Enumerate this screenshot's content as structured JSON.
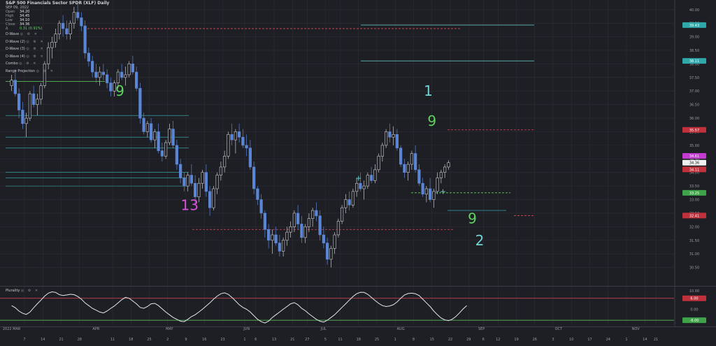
{
  "header": {
    "title": "S&P 500 Financials Sector SPDR (XLF) Daily",
    "date": "SEP 09, 2022",
    "ohlc": [
      {
        "k": "Open",
        "v": "34.20"
      },
      {
        "k": "High",
        "v": "34.45"
      },
      {
        "k": "Low",
        "v": "34.10"
      },
      {
        "k": "Close",
        "v": "34.36"
      }
    ],
    "change": "0.31 (0.91%)"
  },
  "indicators": [
    {
      "label": "D-Wave"
    },
    {
      "label": "D-Wave (2)"
    },
    {
      "label": "D-Wave (3)"
    },
    {
      "label": "D-Wave (4)"
    },
    {
      "label": "Combo"
    },
    {
      "label": "Range Projection"
    }
  ],
  "controls_glyphs": "◎ ⚙ ✕",
  "lower_panel": {
    "label": "Plurality"
  },
  "colors": {
    "background": "#1e1f24",
    "grid": "#2d2f36",
    "up_candle": "#1e1f24",
    "up_border": "#c8cacf",
    "down_candle": "#5b86d6",
    "green_seq": "#5fd35f",
    "red_seq": "#e04858",
    "cyan": "#6fd3d3",
    "magenta": "#d94fd9",
    "price_box_cyan": "#2ea8a8",
    "price_box_red": "#c0313c",
    "price_box_magenta": "#c23ad0",
    "price_box_green": "#3fa34a"
  },
  "chart_data": [
    {
      "type": "candlestick",
      "x_axis_labels": [
        {
          "t": 0.5,
          "label": "2022 MAR"
        },
        {
          "t": 4,
          "label": "7"
        },
        {
          "t": 9,
          "label": "14"
        },
        {
          "t": 14,
          "label": "21"
        },
        {
          "t": 19,
          "label": "28"
        },
        {
          "t": 23.5,
          "label": "APR"
        },
        {
          "t": 28,
          "label": "11"
        },
        {
          "t": 33,
          "label": "18"
        },
        {
          "t": 38,
          "label": "25"
        },
        {
          "t": 43,
          "label": "2"
        },
        {
          "t": 43.5,
          "label": "MAY"
        },
        {
          "t": 48,
          "label": "9"
        },
        {
          "t": 53,
          "label": "16"
        },
        {
          "t": 58,
          "label": "23"
        },
        {
          "t": 64.5,
          "label": "JUN"
        },
        {
          "t": 64,
          "label": "1"
        },
        {
          "t": 67,
          "label": "6"
        },
        {
          "t": 72,
          "label": "13"
        },
        {
          "t": 77,
          "label": "21"
        },
        {
          "t": 81,
          "label": "27"
        },
        {
          "t": 85.5,
          "label": "JUL"
        },
        {
          "t": 86,
          "label": "5"
        },
        {
          "t": 90,
          "label": "11"
        },
        {
          "t": 95,
          "label": "18"
        },
        {
          "t": 100,
          "label": "25"
        },
        {
          "t": 106.5,
          "label": "AUG"
        },
        {
          "t": 105,
          "label": "1"
        },
        {
          "t": 110,
          "label": "8"
        },
        {
          "t": 115,
          "label": "15"
        },
        {
          "t": 120,
          "label": "22"
        },
        {
          "t": 125,
          "label": "29"
        },
        {
          "t": 128.5,
          "label": "SEP"
        },
        {
          "t": 129,
          "label": "6"
        },
        {
          "t": 133,
          "label": "12"
        },
        {
          "t": 138,
          "label": "19"
        },
        {
          "t": 143,
          "label": "26"
        },
        {
          "t": 148,
          "label": "3"
        },
        {
          "t": 149.5,
          "label": "OCT"
        },
        {
          "t": 153,
          "label": "10"
        },
        {
          "t": 158,
          "label": "17"
        },
        {
          "t": 163,
          "label": "24"
        },
        {
          "t": 168,
          "label": "1"
        },
        {
          "t": 170.5,
          "label": "NOV"
        },
        {
          "t": 173,
          "label": "14"
        },
        {
          "t": 176,
          "label": "21"
        }
      ],
      "y_axis": {
        "min": 30.0,
        "max": 40.2,
        "ticks": [
          "40.00",
          "39.50",
          "39.00",
          "38.50",
          "38.00",
          "37.50",
          "37.00",
          "36.50",
          "36.00",
          "35.50",
          "35.00",
          "34.50",
          "34.00",
          "33.50",
          "33.00",
          "32.50",
          "32.00",
          "31.50",
          "31.00",
          "30.50"
        ]
      },
      "candles": [
        [
          37.2,
          37.6,
          37.0,
          37.4
        ],
        [
          37.4,
          37.8,
          36.8,
          36.9
        ],
        [
          36.9,
          37.1,
          36.0,
          36.3
        ],
        [
          36.3,
          36.6,
          35.6,
          35.8
        ],
        [
          35.8,
          36.2,
          35.3,
          36.0
        ],
        [
          36.0,
          37.0,
          35.9,
          36.9
        ],
        [
          36.9,
          37.2,
          36.4,
          36.5
        ],
        [
          36.5,
          36.9,
          36.1,
          36.7
        ],
        [
          36.7,
          37.3,
          36.5,
          37.2
        ],
        [
          37.2,
          38.1,
          37.1,
          38.0
        ],
        [
          38.0,
          38.8,
          37.8,
          38.6
        ],
        [
          38.6,
          39.0,
          38.2,
          38.8
        ],
        [
          38.8,
          39.3,
          38.6,
          39.1
        ],
        [
          39.1,
          39.6,
          38.9,
          39.5
        ],
        [
          39.5,
          39.8,
          39.0,
          39.3
        ],
        [
          39.3,
          39.6,
          38.9,
          39.1
        ],
        [
          39.1,
          39.6,
          38.9,
          39.5
        ],
        [
          39.5,
          40.1,
          39.3,
          39.9
        ],
        [
          39.9,
          40.2,
          39.6,
          39.7
        ],
        [
          39.7,
          39.9,
          39.2,
          39.4
        ],
        [
          39.4,
          39.6,
          38.2,
          38.4
        ],
        [
          38.4,
          38.6,
          37.9,
          38.1
        ],
        [
          38.1,
          38.3,
          37.5,
          37.7
        ],
        [
          37.7,
          38.0,
          37.3,
          37.5
        ],
        [
          37.5,
          37.9,
          37.2,
          37.7
        ],
        [
          37.7,
          38.0,
          37.4,
          37.6
        ],
        [
          37.6,
          37.8,
          37.1,
          37.3
        ],
        [
          37.3,
          37.5,
          36.8,
          37.0
        ],
        [
          37.0,
          37.4,
          36.8,
          37.3
        ],
        [
          37.3,
          37.8,
          37.1,
          37.7
        ],
        [
          37.7,
          38.0,
          37.4,
          37.5
        ],
        [
          37.5,
          37.9,
          37.2,
          37.6
        ],
        [
          37.6,
          38.1,
          37.5,
          38.0
        ],
        [
          38.0,
          38.3,
          37.6,
          37.7
        ],
        [
          37.7,
          37.9,
          37.0,
          37.1
        ],
        [
          37.1,
          37.3,
          35.8,
          36.0
        ],
        [
          36.0,
          36.2,
          35.4,
          35.5
        ],
        [
          35.5,
          35.9,
          35.3,
          35.8
        ],
        [
          35.8,
          36.0,
          35.1,
          35.2
        ],
        [
          35.2,
          35.6,
          34.9,
          35.5
        ],
        [
          35.5,
          35.8,
          34.7,
          34.8
        ],
        [
          34.8,
          35.1,
          34.4,
          34.6
        ],
        [
          34.6,
          35.2,
          34.5,
          35.1
        ],
        [
          35.1,
          35.8,
          35.0,
          35.6
        ],
        [
          35.6,
          35.9,
          34.9,
          35.0
        ],
        [
          35.0,
          35.2,
          34.1,
          34.3
        ],
        [
          34.3,
          34.5,
          33.6,
          33.8
        ],
        [
          33.8,
          34.0,
          33.3,
          33.5
        ],
        [
          33.5,
          34.0,
          33.3,
          33.9
        ],
        [
          33.9,
          34.3,
          33.5,
          33.6
        ],
        [
          33.6,
          33.9,
          32.8,
          33.1
        ],
        [
          33.1,
          33.8,
          32.9,
          33.6
        ],
        [
          33.6,
          34.1,
          33.4,
          34.0
        ],
        [
          34.0,
          34.3,
          33.1,
          33.3
        ],
        [
          33.3,
          33.5,
          32.4,
          32.7
        ],
        [
          32.7,
          33.5,
          32.6,
          33.4
        ],
        [
          33.4,
          34.0,
          33.2,
          33.9
        ],
        [
          33.9,
          34.4,
          33.7,
          34.2
        ],
        [
          34.2,
          34.8,
          34.0,
          34.6
        ],
        [
          34.6,
          35.5,
          34.5,
          35.4
        ],
        [
          35.4,
          35.8,
          35.0,
          35.2
        ],
        [
          35.2,
          35.6,
          34.7,
          35.5
        ],
        [
          35.5,
          35.8,
          35.1,
          35.3
        ],
        [
          35.3,
          35.6,
          34.9,
          35.0
        ],
        [
          35.0,
          35.4,
          34.6,
          34.9
        ],
        [
          34.9,
          35.2,
          34.1,
          34.2
        ],
        [
          34.2,
          34.4,
          33.2,
          33.4
        ],
        [
          33.4,
          33.5,
          32.8,
          33.0
        ],
        [
          33.0,
          33.2,
          32.3,
          32.5
        ],
        [
          32.5,
          32.6,
          31.6,
          31.9
        ],
        [
          31.9,
          32.1,
          31.2,
          31.5
        ],
        [
          31.5,
          31.9,
          31.0,
          31.7
        ],
        [
          31.7,
          32.0,
          31.3,
          31.4
        ],
        [
          31.4,
          31.7,
          30.9,
          31.1
        ],
        [
          31.1,
          31.6,
          30.9,
          31.5
        ],
        [
          31.5,
          32.0,
          31.3,
          31.8
        ],
        [
          31.8,
          32.2,
          31.6,
          32.0
        ],
        [
          32.0,
          32.6,
          31.8,
          32.5
        ],
        [
          32.5,
          32.8,
          31.9,
          32.1
        ],
        [
          32.1,
          32.4,
          31.4,
          31.6
        ],
        [
          31.6,
          32.1,
          31.4,
          32.0
        ],
        [
          32.0,
          32.5,
          31.8,
          32.3
        ],
        [
          32.3,
          32.7,
          32.0,
          32.6
        ],
        [
          32.6,
          32.9,
          32.2,
          32.4
        ],
        [
          32.4,
          32.6,
          31.5,
          31.7
        ],
        [
          31.7,
          32.0,
          31.2,
          31.4
        ],
        [
          31.4,
          31.6,
          30.6,
          30.8
        ],
        [
          30.8,
          31.3,
          30.5,
          31.2
        ],
        [
          31.2,
          31.8,
          31.0,
          31.7
        ],
        [
          31.7,
          32.3,
          31.6,
          32.2
        ],
        [
          32.2,
          32.8,
          32.1,
          32.7
        ],
        [
          32.7,
          33.2,
          32.5,
          33.0
        ],
        [
          33.0,
          33.3,
          32.6,
          32.8
        ],
        [
          32.8,
          33.4,
          32.7,
          33.3
        ],
        [
          33.3,
          33.8,
          33.1,
          33.6
        ],
        [
          33.6,
          34.0,
          33.3,
          33.4
        ],
        [
          33.4,
          33.7,
          33.0,
          33.5
        ],
        [
          33.5,
          34.0,
          33.4,
          33.9
        ],
        [
          33.9,
          34.2,
          33.6,
          33.7
        ],
        [
          33.7,
          34.3,
          33.6,
          34.1
        ],
        [
          34.1,
          34.7,
          34.0,
          34.6
        ],
        [
          34.6,
          35.1,
          34.4,
          35.0
        ],
        [
          35.0,
          35.6,
          34.9,
          35.5
        ],
        [
          35.5,
          35.8,
          35.1,
          35.3
        ],
        [
          35.3,
          35.7,
          35.0,
          35.4
        ],
        [
          35.4,
          35.6,
          34.8,
          34.9
        ],
        [
          34.9,
          35.0,
          34.2,
          34.3
        ],
        [
          34.3,
          34.5,
          33.8,
          34.0
        ],
        [
          34.0,
          34.4,
          33.7,
          34.3
        ],
        [
          34.3,
          34.8,
          34.1,
          34.7
        ],
        [
          34.7,
          35.0,
          34.0,
          34.1
        ],
        [
          34.1,
          34.3,
          33.5,
          33.6
        ],
        [
          33.6,
          33.8,
          33.1,
          33.2
        ],
        [
          33.2,
          33.5,
          32.9,
          33.4
        ],
        [
          33.4,
          33.8,
          32.9,
          33.0
        ],
        [
          33.0,
          33.4,
          32.7,
          33.3
        ],
        [
          33.3,
          34.0,
          33.2,
          33.8
        ],
        [
          33.8,
          34.1,
          33.6,
          34.0
        ],
        [
          34.0,
          34.3,
          33.8,
          34.2
        ],
        [
          34.2,
          34.45,
          34.1,
          34.36
        ]
      ],
      "reference_lines": [
        {
          "price": 39.43,
          "label": "39.43",
          "style": "solid",
          "color": "cyan"
        },
        {
          "price": 38.11,
          "label": "38.11",
          "style": "solid",
          "color": "cyan"
        },
        {
          "price": 39.3,
          "style": "dashed",
          "color": "red"
        },
        {
          "price": 35.57,
          "label": "35.57",
          "style": "dashed",
          "color": "red"
        },
        {
          "price": 33.25,
          "label": "33.25",
          "style": "dashed",
          "color": "green"
        },
        {
          "price": 32.41,
          "label": "32.41",
          "style": "dashed",
          "color": "red"
        },
        {
          "price": 31.9,
          "style": "dashed",
          "color": "red"
        },
        {
          "price": 37.35,
          "style": "solid",
          "color": "green"
        }
      ],
      "price_boxes": [
        {
          "price": 34.61,
          "label": "34.61",
          "color": "magenta"
        },
        {
          "price": 34.36,
          "label": "34.36",
          "color": "white"
        },
        {
          "price": 34.11,
          "label": "34.11",
          "color": "red"
        }
      ],
      "annotations": [
        {
          "text": "9",
          "t": 30,
          "price": 37.0,
          "color": "green",
          "size": "large"
        },
        {
          "text": "13",
          "t": 49,
          "price": 32.8,
          "color": "magenta",
          "size": "large"
        },
        {
          "text": "1",
          "t": 114,
          "price": 37.0,
          "color": "cyan",
          "size": "large"
        },
        {
          "text": "9",
          "t": 115,
          "price": 35.9,
          "color": "green",
          "size": "large"
        },
        {
          "text": "9",
          "t": 126,
          "price": 32.3,
          "color": "green",
          "size": "large"
        },
        {
          "text": "2",
          "t": 128,
          "price": 31.5,
          "color": "cyan",
          "size": "large"
        },
        {
          "text": "+",
          "t": 95,
          "price": 33.8,
          "color": "cyan",
          "size": "medium"
        },
        {
          "text": "+",
          "t": 118,
          "price": 33.3,
          "color": "cyan",
          "size": "medium"
        }
      ]
    },
    {
      "type": "line",
      "name": "Plurality",
      "y_ticks": [
        "10.00",
        "6.00",
        "0.00",
        "-6.00"
      ],
      "reference_levels": [
        {
          "value": 6.0,
          "label": "6.00",
          "color": "red"
        },
        {
          "value": -6.0,
          "label": "-6.00",
          "color": "green"
        }
      ],
      "ylim": [
        -9,
        12
      ],
      "values": [
        2.0,
        0.8,
        -1.0,
        -2.2,
        -2.8,
        -1.5,
        0.8,
        3.0,
        5.0,
        7.2,
        8.8,
        9.5,
        9.2,
        8.0,
        7.5,
        7.8,
        8.2,
        8.0,
        7.0,
        5.5,
        3.5,
        2.0,
        0.5,
        -0.5,
        -1.5,
        -2.0,
        -1.0,
        0.5,
        1.8,
        3.5,
        5.2,
        6.5,
        6.0,
        4.5,
        3.0,
        1.0,
        0.5,
        1.5,
        3.0,
        3.2,
        2.0,
        0.2,
        -1.5,
        -3.0,
        -4.5,
        -5.5,
        -6.5,
        -6.8,
        -5.5,
        -4.0,
        -3.0,
        -1.5,
        0.0,
        1.8,
        3.5,
        5.5,
        7.2,
        8.5,
        9.0,
        8.2,
        6.5,
        4.5,
        2.5,
        1.0,
        0.0,
        -1.5,
        -3.5,
        -5.5,
        -6.8,
        -7.5,
        -6.5,
        -4.5,
        -3.0,
        -1.5,
        0.0,
        1.5,
        3.0,
        3.6,
        2.5,
        0.5,
        -0.8,
        -2.5,
        -4.0,
        -5.5,
        -6.5,
        -7.0,
        -6.0,
        -4.5,
        -3.0,
        -1.0,
        1.0,
        3.0,
        5.0,
        7.0,
        8.5,
        9.3,
        9.2,
        8.2,
        6.5,
        4.8,
        3.2,
        2.0,
        1.5,
        1.8,
        2.5,
        4.0,
        6.0,
        7.8,
        8.6,
        8.8,
        8.5,
        7.5,
        5.5,
        3.5,
        1.5,
        -1.0,
        -3.0,
        -4.8,
        -5.8,
        -6.2,
        -5.5,
        -4.0,
        -2.0,
        0.2,
        2.0
      ]
    }
  ]
}
